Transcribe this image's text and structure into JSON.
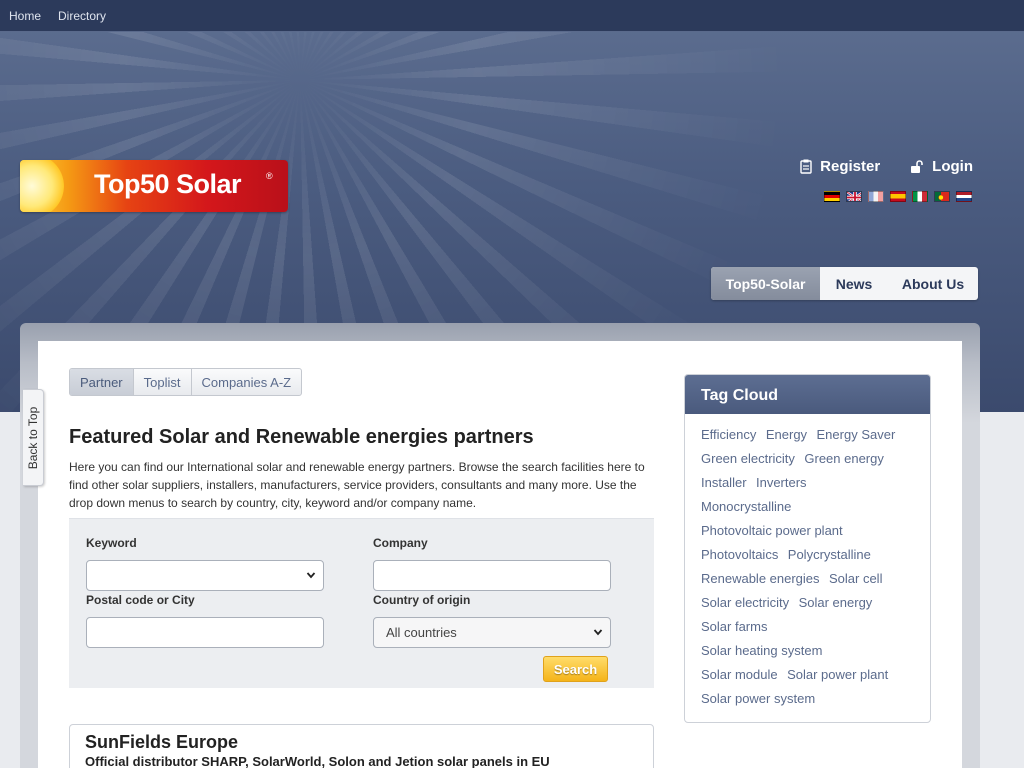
{
  "topbar": {
    "links": [
      "Home",
      "Directory"
    ]
  },
  "logo": {
    "text": "Top50 Solar",
    "registered": "®"
  },
  "account": {
    "register": "Register",
    "login": "Login"
  },
  "languages": [
    "german-flag",
    "uk-flag",
    "french-flag",
    "spanish-flag",
    "italian-flag",
    "portuguese-flag",
    "dutch-flag"
  ],
  "main_nav": {
    "items": [
      "Top50-Solar",
      "News",
      "About Us"
    ],
    "active": "Top50-Solar"
  },
  "back_to_top": "Back to Top",
  "sub_tabs": {
    "items": [
      "Partner",
      "Toplist",
      "Companies A-Z"
    ],
    "active": "Partner"
  },
  "page": {
    "heading": "Featured Solar and Renewable energies partners",
    "intro": "Here you can find our International solar and renewable energy partners. Browse the search facilities here to find other solar suppliers, installers, manufacturers, service providers, consultants and many more. Use the drop down menus to search by country, city, keyword and/or company name."
  },
  "search_form": {
    "keyword_label": "Keyword",
    "keyword_value": "",
    "company_label": "Company",
    "company_value": "",
    "postal_label": "Postal code or City",
    "postal_value": "",
    "country_label": "Country of origin",
    "country_value": "All countries",
    "submit_label": "Search"
  },
  "listing": {
    "name": "SunFields Europe",
    "tagline": "Official distributor SHARP, SolarWorld, Solon and Jetion solar panels in EU"
  },
  "tag_cloud": {
    "title": "Tag Cloud",
    "tags": [
      "Efficiency",
      "Energy",
      "Energy Saver",
      "Green electricity",
      "Green energy",
      "Installer",
      "Inverters",
      "Monocrystalline",
      "Photovoltaic power plant",
      "Photovoltaics",
      "Polycrystalline",
      "Renewable energies",
      "Solar cell",
      "Solar electricity",
      "Solar energy",
      "Solar farms",
      "Solar heating system",
      "Solar module",
      "Solar power plant",
      "Solar power system"
    ]
  },
  "colors": {
    "header_bg": "#4b5c80",
    "topbar_bg": "#2c3a5b",
    "link_text": "#5b6b8c",
    "search_button": "#f5b41a"
  }
}
